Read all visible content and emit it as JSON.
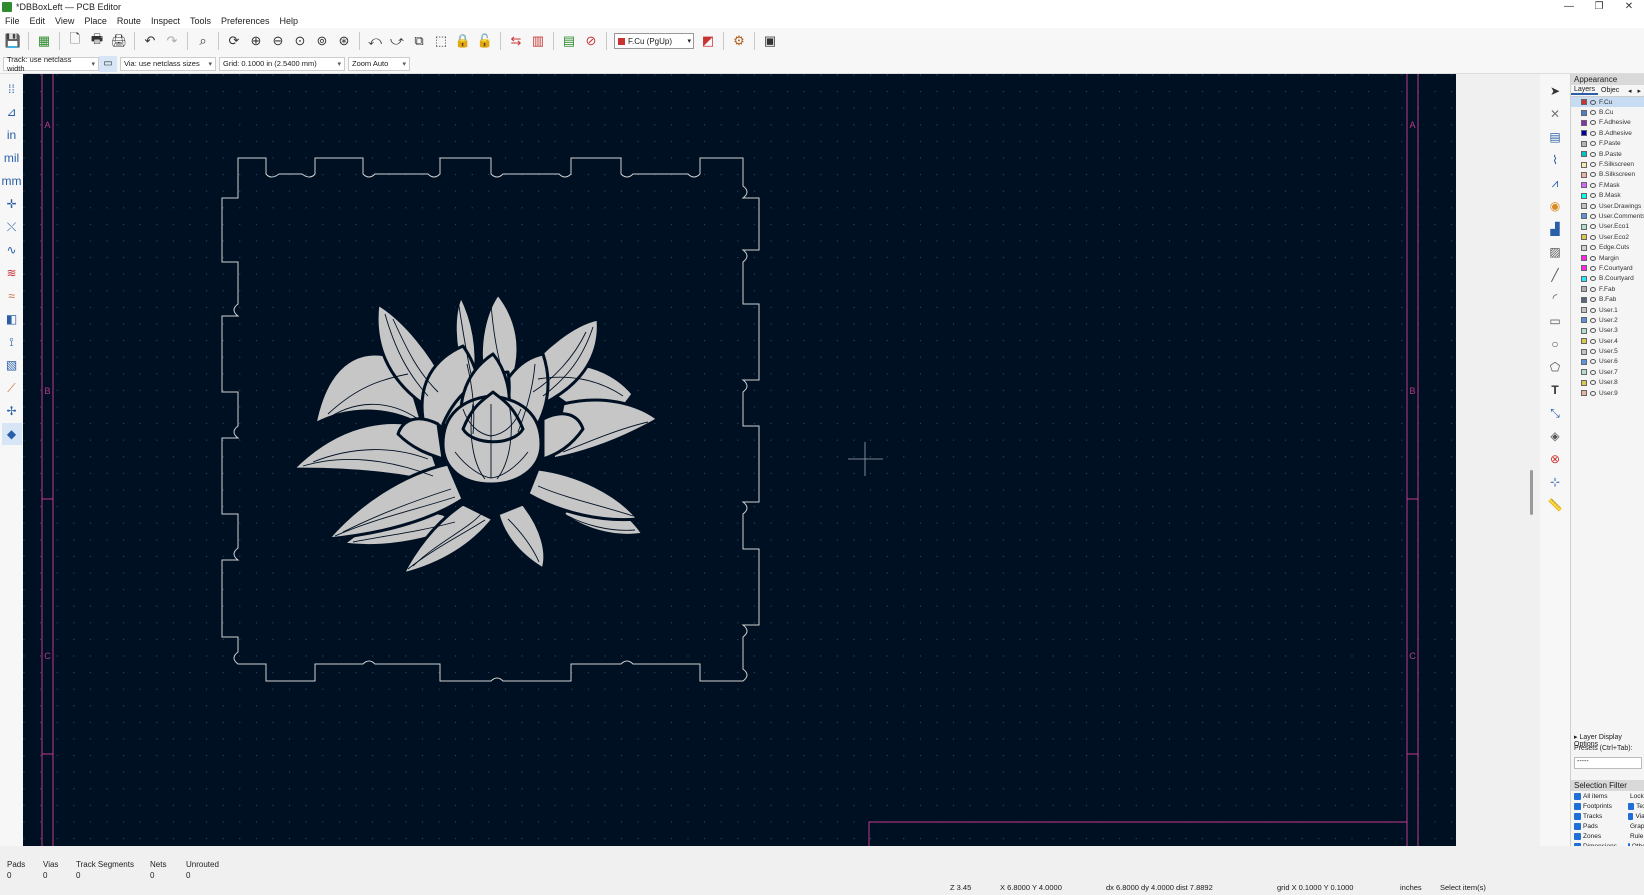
{
  "window": {
    "title": "*DBBoxLeft — PCB Editor",
    "controls": [
      "—",
      "❐",
      "✕"
    ]
  },
  "menu": [
    "File",
    "Edit",
    "View",
    "Place",
    "Route",
    "Inspect",
    "Tools",
    "Preferences",
    "Help"
  ],
  "options": {
    "track": "Track: use netclass width",
    "via": "Via: use netclass sizes",
    "grid": "Grid: 0.1000 in (2.5400 mm)",
    "zoom": "Zoom Auto"
  },
  "active_layer": {
    "name": "F.Cu (PgUp)",
    "color": "#c83434"
  },
  "canvas": {
    "background": "#001023",
    "border_color": "#c0388f",
    "outline_color": "#d0d0d0",
    "art_color": "#c2c2c2",
    "zone_labels_left": [
      "A",
      "B",
      "C"
    ],
    "zone_labels_right": [
      "A",
      "B",
      "C"
    ]
  },
  "appearance": {
    "title": "Appearance",
    "tabs": [
      "Layers",
      "Objec"
    ],
    "layers": [
      {
        "name": "F.Cu",
        "color": "#c83434"
      },
      {
        "name": "B.Cu",
        "color": "#4d7fc4"
      },
      {
        "name": "F.Adhesive",
        "color": "#8432b4"
      },
      {
        "name": "B.Adhesive",
        "color": "#0000a8"
      },
      {
        "name": "F.Paste",
        "color": "#b4b4b4"
      },
      {
        "name": "B.Paste",
        "color": "#00c2c2"
      },
      {
        "name": "F.Silkscreen",
        "color": "#f2eda1"
      },
      {
        "name": "B.Silkscreen",
        "color": "#e8b2a7"
      },
      {
        "name": "F.Mask",
        "color": "#d864ff"
      },
      {
        "name": "B.Mask",
        "color": "#02ffee"
      },
      {
        "name": "User.Drawings",
        "color": "#c2c2c2"
      },
      {
        "name": "User.Comments",
        "color": "#5994dc"
      },
      {
        "name": "User.Eco1",
        "color": "#b4dbd2"
      },
      {
        "name": "User.Eco2",
        "color": "#d8c852"
      },
      {
        "name": "Edge.Cuts",
        "color": "#d0d2cd"
      },
      {
        "name": "Margin",
        "color": "#ff26e2"
      },
      {
        "name": "F.Courtyard",
        "color": "#ff26e2"
      },
      {
        "name": "B.Courtyard",
        "color": "#26e9ff"
      },
      {
        "name": "F.Fab",
        "color": "#afafaf"
      },
      {
        "name": "B.Fab",
        "color": "#58657f"
      },
      {
        "name": "User.1",
        "color": "#c2c2c2"
      },
      {
        "name": "User.2",
        "color": "#5994dc"
      },
      {
        "name": "User.3",
        "color": "#b4dbd2"
      },
      {
        "name": "User.4",
        "color": "#d8c852"
      },
      {
        "name": "User.5",
        "color": "#c2c2c2"
      },
      {
        "name": "User.6",
        "color": "#5994dc"
      },
      {
        "name": "User.7",
        "color": "#b4dbd2"
      },
      {
        "name": "User.8",
        "color": "#d8c852"
      },
      {
        "name": "User.9",
        "color": "#e8b2a7"
      }
    ],
    "layer_display_options": "Layer Display Options",
    "presets_label": "Presets (Ctrl+Tab):",
    "presets_value": "-----"
  },
  "selection_filter": {
    "title": "Selection Filter",
    "items": [
      "All items",
      "Locked",
      "Footprints",
      "Text",
      "Tracks",
      "Vias",
      "Pads",
      "Graphics",
      "Zones",
      "Rule Areas",
      "Dimensions",
      "Other"
    ]
  },
  "messages": [
    {
      "label": "Pads",
      "value": "0"
    },
    {
      "label": "Vias",
      "value": "0"
    },
    {
      "label": "Track Segments",
      "value": "0"
    },
    {
      "label": "Nets",
      "value": "0"
    },
    {
      "label": "Unrouted",
      "value": "0"
    }
  ],
  "status": {
    "zoom": "Z 3.45",
    "xy": "X 6.8000  Y 4.0000",
    "delta": "dx 6.8000  dy 4.0000  dist 7.8892",
    "grid": "grid X 0.1000  Y 0.1000",
    "units": "inches",
    "mode": "Select item(s)"
  }
}
